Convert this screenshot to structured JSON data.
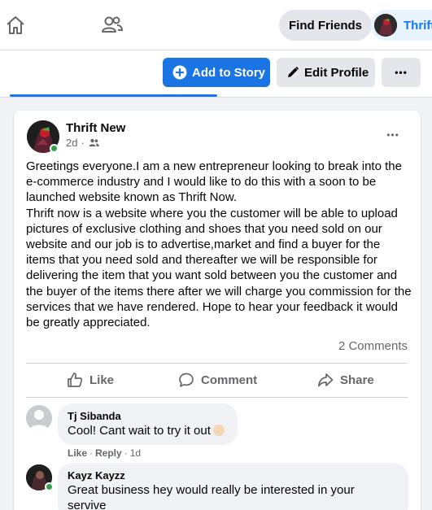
{
  "topbar": {
    "find_friends_label": "Find Friends",
    "profile_name": "Thrift"
  },
  "actionbar": {
    "add_story_label": "Add to Story",
    "edit_profile_label": "Edit Profile",
    "more_label": "•••"
  },
  "post": {
    "author": "Thrift New",
    "time": "2d",
    "menu_label": "•••",
    "paragraphs": [
      "Greetings everyone.I am a new entrepreneur looking to break into the e-commerce industry and I would like to do this with a soon to be launched website known as Thrift Now.",
      "Thrift now is a website where you the customer will be  able to upload pictures of exclusive clothing and shoes that you need sold on our website  and our job is to advertise,market and find a buyer for the items that you need sold and thereafter we will be responsible for delivering the item that you want sold between you the customer and the buyer of the items there after we will charge you commission for the services that we have rendered. Hope to hear your feedback it would be greatly appreciated."
    ],
    "comment_count": "2 Comments",
    "actions": {
      "like": "Like",
      "comment": "Comment",
      "share": "Share"
    }
  },
  "comments": [
    {
      "author": "Tj Sibanda",
      "text": "Cool! Cant wait to try it out",
      "like_label": "Like",
      "reply_label": "Reply",
      "sep": "·",
      "time": "1d"
    },
    {
      "author": "Kayz Kayzz",
      "text": "Great business hey would really be interested in your servive"
    }
  ],
  "colors": {
    "accent": "#1877f2",
    "online": "#31a24c"
  }
}
